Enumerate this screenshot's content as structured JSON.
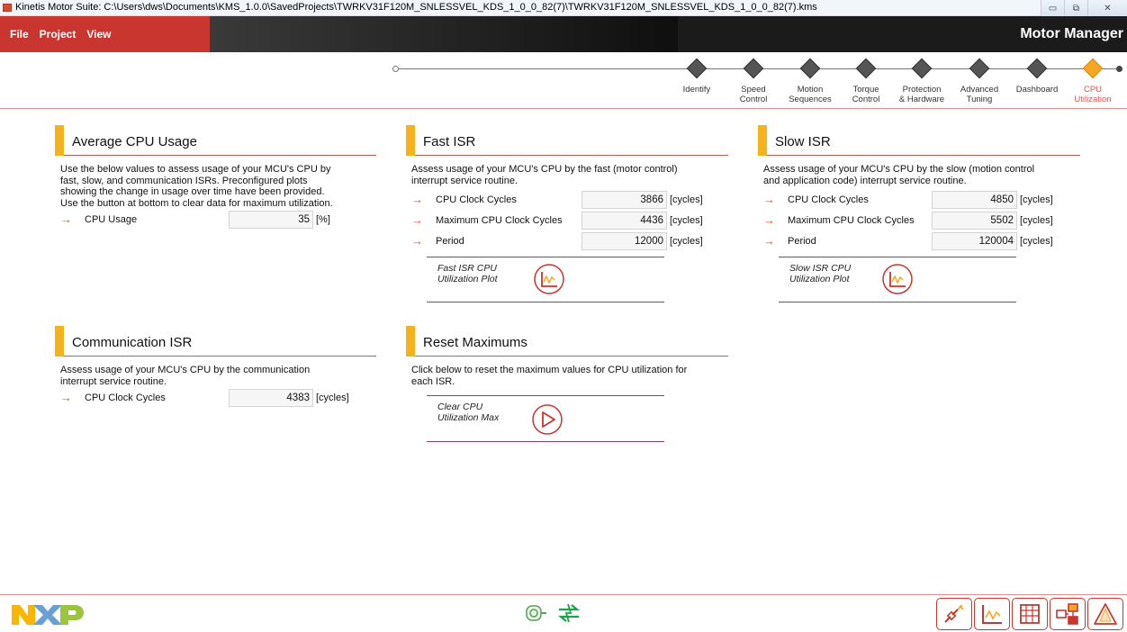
{
  "window": {
    "title": "Kinetis Motor Suite: C:\\Users\\dws\\Documents\\KMS_1.0.0\\SavedProjects\\TWRKV31F120M_SNLESSVEL_KDS_1_0_0_82(7)\\TWRKV31F120M_SNLESSVEL_KDS_1_0_0_82(7).kms",
    "minimize_glyph": "▭",
    "restore_glyph": "⧉",
    "close_glyph": "✕"
  },
  "menu": {
    "file": "File",
    "project": "Project",
    "view": "View",
    "app_name": "Motor Manager"
  },
  "workflow": {
    "steps": [
      {
        "l1": "Identify",
        "l2": ""
      },
      {
        "l1": "Speed",
        "l2": "Control"
      },
      {
        "l1": "Motion",
        "l2": "Sequences"
      },
      {
        "l1": "Torque",
        "l2": "Control"
      },
      {
        "l1": "Protection",
        "l2": "& Hardware"
      },
      {
        "l1": "Advanced",
        "l2": "Tuning"
      },
      {
        "l1": "Dashboard",
        "l2": ""
      },
      {
        "l1": "CPU",
        "l2": "Utilization"
      }
    ],
    "active_index": 7
  },
  "panels": {
    "avg": {
      "title": "Average CPU Usage",
      "desc1": "Use the below values to assess usage of your MCU's CPU by",
      "desc2": "fast, slow, and communication ISRs.  Preconfigured plots",
      "desc3": "showing the change in usage over time have been provided.",
      "desc4": "Use the button at bottom to clear data for maximum utilization.",
      "rows": [
        {
          "label": "CPU Usage",
          "value": "35",
          "unit": "[%]"
        }
      ]
    },
    "fast": {
      "title": "Fast ISR",
      "desc1": "Assess usage of your MCU's CPU by the fast (motor control)",
      "desc2": "interrupt service routine.",
      "rows": [
        {
          "label": "CPU Clock Cycles",
          "value": "3866",
          "unit": "[cycles]"
        },
        {
          "label": "Maximum CPU Clock Cycles",
          "value": "4436",
          "unit": "[cycles]"
        },
        {
          "label": "Period",
          "value": "12000",
          "unit": "[cycles]"
        }
      ],
      "plot_label1": "Fast ISR CPU",
      "plot_label2": "Utilization Plot"
    },
    "slow": {
      "title": "Slow ISR",
      "desc1": "Assess usage of your MCU's CPU by the slow (motion control",
      "desc2": "and application code) interrupt service routine.",
      "rows": [
        {
          "label": "CPU Clock Cycles",
          "value": "4850",
          "unit": "[cycles]"
        },
        {
          "label": "Maximum CPU Clock Cycles",
          "value": "5502",
          "unit": "[cycles]"
        },
        {
          "label": "Period",
          "value": "120004",
          "unit": "[cycles]"
        }
      ],
      "plot_label1": "Slow ISR CPU",
      "plot_label2": "Utilization Plot"
    },
    "comm": {
      "title": "Communication ISR",
      "desc1": "Assess usage of your MCU's CPU by the communication",
      "desc2": "interrupt service routine.",
      "rows": [
        {
          "label": "CPU Clock Cycles",
          "value": "4383",
          "unit": "[cycles]"
        }
      ]
    },
    "reset": {
      "title": "Reset Maximums",
      "desc1": "Click below to reset the maximum values for CPU utilization for",
      "desc2": "each ISR.",
      "button_label1": "Clear CPU",
      "button_label2": "Utilization Max"
    }
  },
  "icons": {
    "arrow": "→",
    "row_arrow_name": "arrow-right-icon",
    "plot": "plot-icon",
    "play": "play-icon",
    "nxp_logo": "nxp-logo",
    "motor": "motor-icon",
    "connection": "connection-icon"
  },
  "colors": {
    "accent_red": "#c8362f",
    "accent_orange": "#f5b21b",
    "active_step": "#f5a623"
  }
}
